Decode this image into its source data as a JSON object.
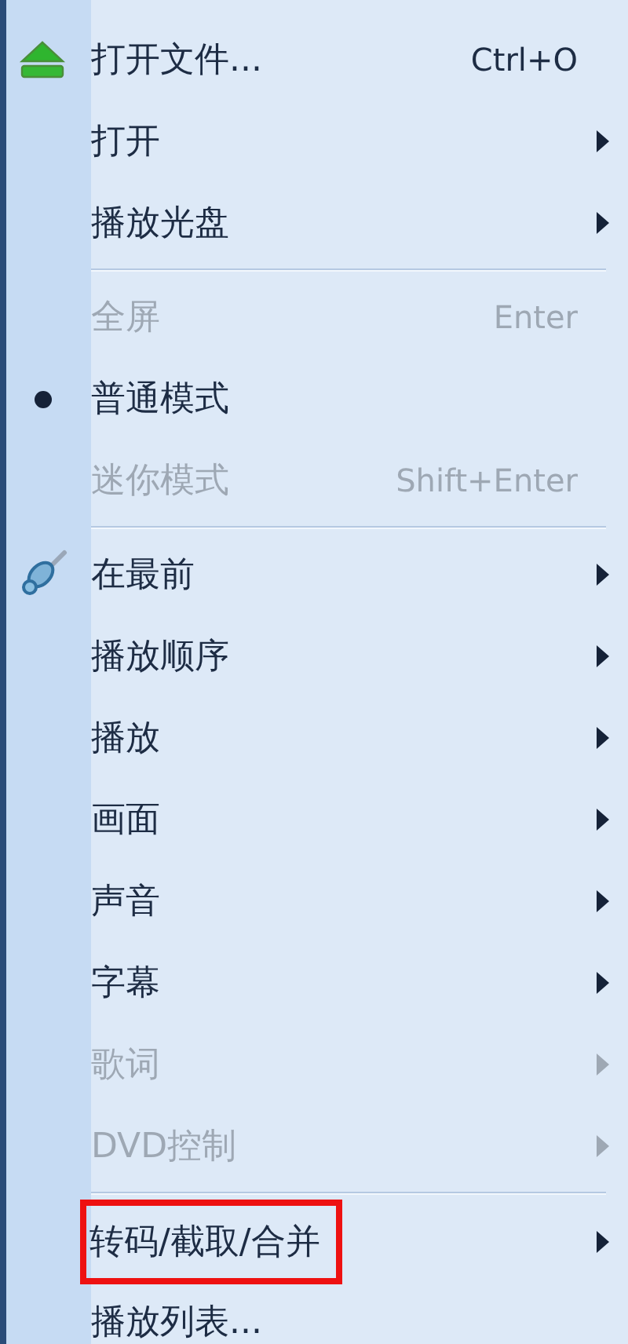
{
  "menu": {
    "items": [
      {
        "kind": "item",
        "label": "打开文件...",
        "shortcut": "Ctrl+O",
        "submenu": false,
        "disabled": false,
        "checked": false,
        "highlighted": false
      },
      {
        "kind": "item",
        "label": "打开",
        "submenu": true,
        "disabled": false,
        "checked": false,
        "highlighted": false
      },
      {
        "kind": "item",
        "label": "播放光盘",
        "submenu": true,
        "disabled": false,
        "checked": false,
        "highlighted": false
      },
      {
        "kind": "separator"
      },
      {
        "kind": "item",
        "label": "全屏",
        "shortcut": "Enter",
        "submenu": false,
        "disabled": true,
        "checked": false,
        "highlighted": false
      },
      {
        "kind": "item",
        "label": "普通模式",
        "submenu": false,
        "disabled": false,
        "checked": true,
        "highlighted": false
      },
      {
        "kind": "item",
        "label": "迷你模式",
        "shortcut": "Shift+Enter",
        "submenu": false,
        "disabled": true,
        "checked": false,
        "highlighted": false
      },
      {
        "kind": "separator"
      },
      {
        "kind": "item",
        "label": "在最前",
        "submenu": true,
        "disabled": false,
        "checked": false,
        "highlighted": false
      },
      {
        "kind": "item",
        "label": "播放顺序",
        "submenu": true,
        "disabled": false,
        "checked": false,
        "highlighted": false
      },
      {
        "kind": "item",
        "label": "播放",
        "submenu": true,
        "disabled": false,
        "checked": false,
        "highlighted": false
      },
      {
        "kind": "item",
        "label": "画面",
        "submenu": true,
        "disabled": false,
        "checked": false,
        "highlighted": false
      },
      {
        "kind": "item",
        "label": "声音",
        "submenu": true,
        "disabled": false,
        "checked": false,
        "highlighted": false
      },
      {
        "kind": "item",
        "label": "字幕",
        "submenu": true,
        "disabled": false,
        "checked": false,
        "highlighted": false
      },
      {
        "kind": "item",
        "label": "歌词",
        "submenu": true,
        "disabled": true,
        "checked": false,
        "highlighted": false
      },
      {
        "kind": "item",
        "label": "DVD控制",
        "submenu": true,
        "disabled": true,
        "checked": false,
        "highlighted": false
      },
      {
        "kind": "separator"
      },
      {
        "kind": "item",
        "label": "转码/截取/合并",
        "submenu": true,
        "disabled": false,
        "checked": false,
        "highlighted": true
      },
      {
        "kind": "item",
        "label": "播放列表...",
        "submenu": false,
        "disabled": false,
        "checked": false,
        "highlighted": false
      }
    ]
  }
}
